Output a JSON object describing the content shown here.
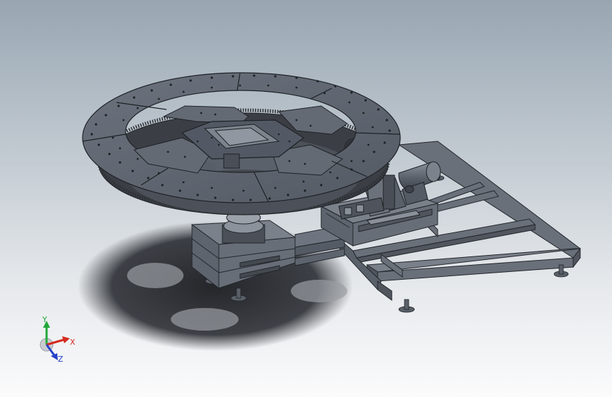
{
  "viewport": {
    "background_top": "#98a6b2",
    "background_bottom": "#fbfbfc",
    "model_color": "#5d6470",
    "model_edge_color": "#23262b"
  },
  "triad": {
    "x_label": "X",
    "y_label": "Y",
    "z_label": "Z",
    "x_color": "#d42a20",
    "y_color": "#22a83a",
    "z_color": "#2540c8"
  }
}
